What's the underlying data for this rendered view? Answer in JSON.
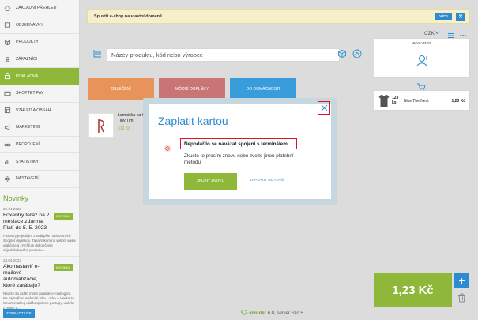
{
  "sidebar": {
    "items": [
      {
        "label": "ZÁKLADNÍ PŘEHLED",
        "icon": "home-icon"
      },
      {
        "label": "OBJEDNÁVKY",
        "icon": "orders-icon"
      },
      {
        "label": "PRODUKTY",
        "icon": "box-icon"
      },
      {
        "label": "ZÁKAZNÍCI",
        "icon": "users-icon"
      },
      {
        "label": "POKLADNA",
        "icon": "register-icon",
        "active": true
      },
      {
        "label": "SHOPTET PAY",
        "icon": "card-icon"
      },
      {
        "label": "VZHLED A OBSAH",
        "icon": "layout-icon"
      },
      {
        "label": "MARKETING",
        "icon": "megaphone-icon"
      },
      {
        "label": "PROPOJENÍ",
        "icon": "link-icon"
      },
      {
        "label": "STATISTIKY",
        "icon": "chart-icon"
      },
      {
        "label": "NASTAVENÍ",
        "icon": "gear-icon"
      }
    ],
    "news": {
      "title": "Novinky",
      "items": [
        {
          "date": "25.04.2023",
          "headline": "Foxentry teraz na 2 mesiace zdarma. Platí do 5. 5. 2023",
          "badge": "NOVINKA",
          "text": "Foxentry je jedným z najlepšie hodnotených Shoptet doplnkov. Zákazníkom na vašom webe uľahčuje a zrýchľuje dokončenie objednávkového procesu...."
        },
        {
          "date": "24.04.2023",
          "headline": "Ako nastaviť e-mailové automatizácie, ktoré zarábajú?",
          "badge": "NOVINKA",
          "text": "Naučte sa za 90 minút zarábať e-mailingom. Na zajtrajšom webinári vám Lucka a Vierka zo Smartemailing ukážu správne postupy, ukážky z praxe a..."
        }
      ]
    },
    "show_all": "ZOBRAZIT VŠE"
  },
  "banner": {
    "text": "Spustit e-shop na vlastní doméně",
    "more": "VÍCE",
    "close": "✕"
  },
  "search": {
    "placeholder": "Název produktu, kód nebo výrobce"
  },
  "categories": [
    {
      "label": "OBLEČENÍ",
      "color": "#e8935a"
    },
    {
      "label": "MÓDNÍ DOPLŇKY",
      "color": "#c97575"
    },
    {
      "label": "DO DOMÁCNOSTI",
      "color": "#3a9ddb"
    }
  ],
  "product": {
    "name": "Lampička na k - Tiny Tim",
    "price": "310 Kč"
  },
  "right": {
    "currency": "CZK",
    "customer_label": "ZÁKAZNÍK",
    "cart_item": {
      "qty": "123",
      "unit": "ks",
      "name": "Nike The Next",
      "price": "1,23 Kč"
    },
    "total": "1,23 Kč",
    "plus": "+"
  },
  "footer": {
    "logo": "shoptet",
    "version": "6.0, server Silo 5"
  },
  "modal": {
    "title": "Zaplatit kartou",
    "error_title": "Nepodařilo se navázat spojení s terminálem",
    "error_text": "Zkuste to prosím znovu nebo zvolte jinou platební metodu",
    "retry": "ZKUSIT ZNOVU",
    "cash": "ZAPLATIT HOTOVĚ"
  },
  "colors": {
    "brand_green": "#8fb83a",
    "accent_blue": "#2d8ccf",
    "error_red": "#e0121b"
  }
}
